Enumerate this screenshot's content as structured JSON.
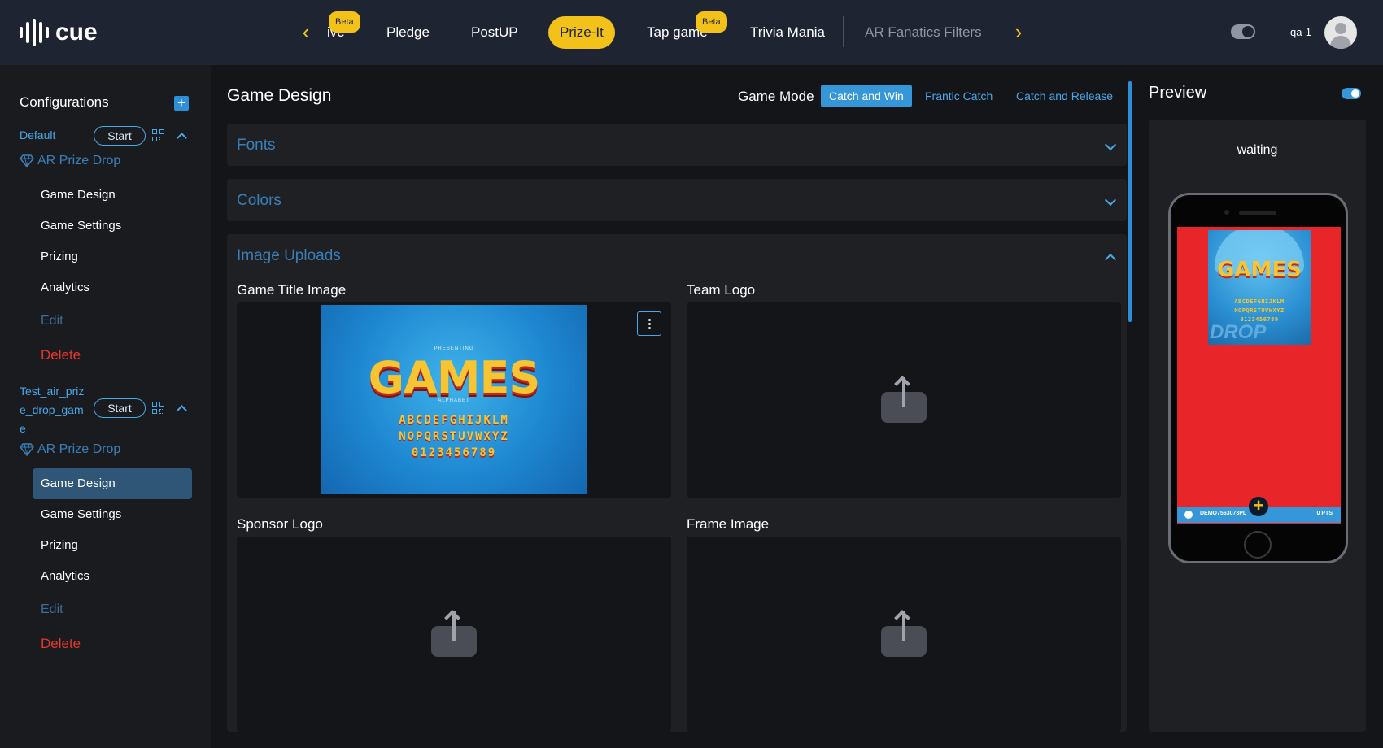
{
  "brand": {
    "name": "cue"
  },
  "topnav": {
    "items": [
      {
        "label": "ive",
        "badge": "Beta"
      },
      {
        "label": "Pledge"
      },
      {
        "label": "PostUP"
      },
      {
        "label": "Prize-It"
      },
      {
        "label": "Tap game",
        "badge": "Beta"
      },
      {
        "label": "Trivia Mania"
      },
      {
        "label": "AR Fanatics Filters"
      }
    ],
    "active_index": 3,
    "username": "qa-1"
  },
  "sidebar": {
    "title": "Configurations",
    "configs": [
      {
        "name": "Default",
        "start_label": "Start",
        "type_label": "AR Prize Drop",
        "menu": [
          "Game Design",
          "Game Settings",
          "Prizing",
          "Analytics",
          "Edit",
          "Delete"
        ]
      },
      {
        "name_lines": [
          "Test_air_priz",
          "e_drop_gam",
          "e"
        ],
        "start_label": "Start",
        "type_label": "AR Prize Drop",
        "menu": [
          "Game Design",
          "Game Settings",
          "Prizing",
          "Analytics",
          "Edit",
          "Delete"
        ],
        "selected": "Game Design"
      }
    ]
  },
  "main": {
    "title": "Game Design",
    "game_mode": {
      "label": "Game Mode",
      "options": [
        "Catch and Win",
        "Frantic Catch",
        "Catch and Release"
      ],
      "selected": "Catch and Win"
    },
    "panels": [
      {
        "title": "Fonts",
        "expanded": false
      },
      {
        "title": "Colors",
        "expanded": false
      },
      {
        "title": "Image Uploads",
        "expanded": true
      }
    ],
    "uploads": [
      {
        "label": "Game Title Image",
        "has_image": true
      },
      {
        "label": "Team Logo",
        "has_image": false
      },
      {
        "label": "Sponsor Logo",
        "has_image": false
      },
      {
        "label": "Frame Image",
        "has_image": false
      }
    ],
    "title_image": {
      "presenting": "PRESENTING",
      "headline": "GAMES",
      "alphabet_caption": "ALPHABET",
      "rows": [
        "ABCDEFGHIJKLM",
        "NOPQRSTUVWXYZ",
        "0123456789"
      ]
    }
  },
  "preview": {
    "title": "Preview",
    "enabled": true,
    "status": "waiting",
    "screen": {
      "headline": "GAMES",
      "rows": [
        "ABCDEFGHIJKLM",
        "NOPQRSTUVWXYZ",
        "0123456789"
      ],
      "overlay_word": "DROP",
      "code": "DEMO7563073PL",
      "points": "0 PTS"
    },
    "colors": {
      "background": "#e8262a",
      "strip": "#3596d8"
    }
  },
  "colors": {
    "accent": "#f3c21a",
    "link": "#4aa7e8",
    "danger": "#e8372e",
    "topbar": "#1e2432"
  }
}
